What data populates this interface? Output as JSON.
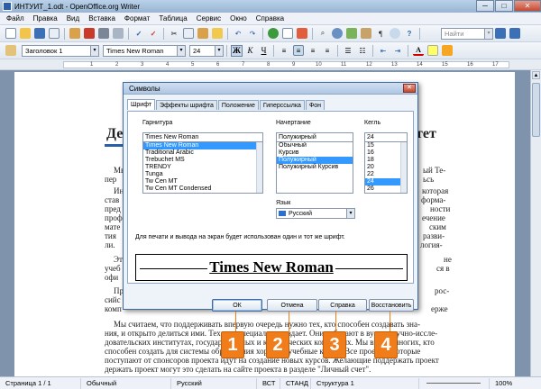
{
  "window": {
    "title": "ИНТУИТ_1.odt - OpenOffice.org Writer",
    "min": "─",
    "max": "□",
    "close": "✕"
  },
  "menu": [
    "Файл",
    "Правка",
    "Вид",
    "Вставка",
    "Формат",
    "Таблица",
    "Сервис",
    "Окно",
    "Справка"
  ],
  "toolbar": {
    "find_placeholder": "Найти"
  },
  "format_bar": {
    "style": "Заголовок 1",
    "font": "Times New Roman",
    "size": "24",
    "bold": "Ж",
    "italic": "К",
    "underline": "Ч"
  },
  "ruler": [
    "1",
    "2",
    "3",
    "4",
    "5",
    "6",
    "7",
    "8",
    "9",
    "10",
    "11",
    "12",
    "13",
    "14",
    "15",
    "16",
    "17"
  ],
  "document": {
    "heading_left": "Де",
    "heading_right": "тет",
    "lines_left": [
      "Мы",
      "пер",
      "Ин",
      "став",
      "пред",
      "проф",
      "мате",
      "тия",
      "ли.",
      "Эт",
      "учеб",
      "офи",
      "Пр",
      "сийс",
      "комп"
    ],
    "lines_right": [
      "ый Те-",
      "ьсь",
      "которая",
      "форма-",
      "ности",
      "ечение",
      "ским",
      "разви-",
      "логия-",
      "не",
      "ся в",
      "рос-",
      "ерже"
    ],
    "bottom_lines": [
      "Мы считаем, что поддерживать впервую очередь нужно тех, кто способен создавать зна-",
      "ния, и открыто делиться ими. Тех, кто специально создает. Они работают в вузах, научно-иссле-",
      "довательских институтах, государственных и коммерческих компаниях. Мы видим многих, кто",
      "способен создать для системы образования хорошие учебные курсы. Все проекты, которые",
      "поступают от спонсоров проекта идут на создание новых курсов. Желающие поддержать проект",
      "держать проект могут это сделать на сайте проекта в разделе \"Личный счет\"."
    ]
  },
  "dialog": {
    "title": "Символы",
    "tabs": [
      "Шрифт",
      "Эффекты шрифта",
      "Положение",
      "Гиперссылка",
      "Фон"
    ],
    "family_label": "Гарнитура",
    "family_value": "Times New Roman",
    "family_list": [
      "Times New Roman",
      "Traditional Arabic",
      "Trebuchet MS",
      "TRENDY",
      "Tunga",
      "Tw Cen MT",
      "Tw Cen MT Condensed"
    ],
    "family_selected": 0,
    "typeface_label": "Начертание",
    "typeface_value": "Полужирный",
    "typeface_list": [
      "Обычный",
      "Курсив",
      "Полужирный",
      "Полужирный Курсив"
    ],
    "typeface_selected": 2,
    "size_label": "Кегль",
    "size_value": "24",
    "size_list": [
      "15",
      "16",
      "18",
      "20",
      "22",
      "24",
      "26"
    ],
    "size_selected": 5,
    "lang_label": "Язык",
    "lang_value": "Русский",
    "info": "Для печати и вывода на экран будет использован один и тот же шрифт.",
    "preview": "Times New Roman",
    "buttons": {
      "ok": "ОК",
      "cancel": "Отмена",
      "help": "Справка",
      "reset": "Восстановить"
    }
  },
  "callouts": [
    "1",
    "2",
    "3",
    "4"
  ],
  "status": {
    "page": "Страница 1 / 1",
    "style": "Обычный",
    "language": "Русский",
    "mode_ins": "ВСТ",
    "mode_std": "СТАНД",
    "structure": "Структура 1",
    "zoom": "100%"
  },
  "colors": {
    "accent": "#f07d1a",
    "selection": "#3399ff",
    "workspace": "#7f93ad"
  }
}
